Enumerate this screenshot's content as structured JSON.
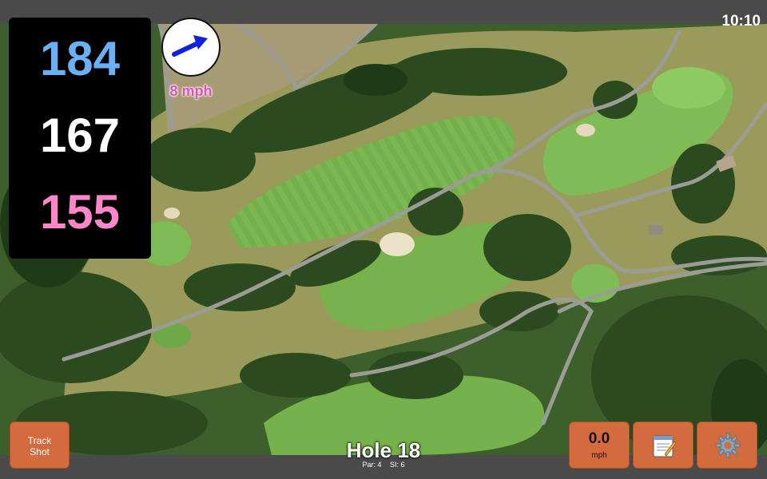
{
  "status_bar": {
    "time": "10:10"
  },
  "yardages": {
    "back": "184",
    "middle": "167",
    "front": "155"
  },
  "wind": {
    "speed_label": "8 mph",
    "direction_icon": "arrow-icon",
    "arrow_color": "#1020e0"
  },
  "buttons": {
    "track_shot_line1": "Track",
    "track_shot_line2": "Shot",
    "speed_value": "0.0",
    "speed_unit": "mph",
    "notes_icon": "notepad-icon",
    "settings_icon": "gear-icon",
    "button_color": "#d46b3c"
  },
  "hole": {
    "title": "Hole 18",
    "par": "Par: 4",
    "stroke_index": "SI: 6"
  },
  "colors": {
    "back_yardage": "#6ab0f5",
    "middle_yardage": "#ffffff",
    "front_yardage": "#ff86c8",
    "wind_text": "#e64fb2"
  }
}
